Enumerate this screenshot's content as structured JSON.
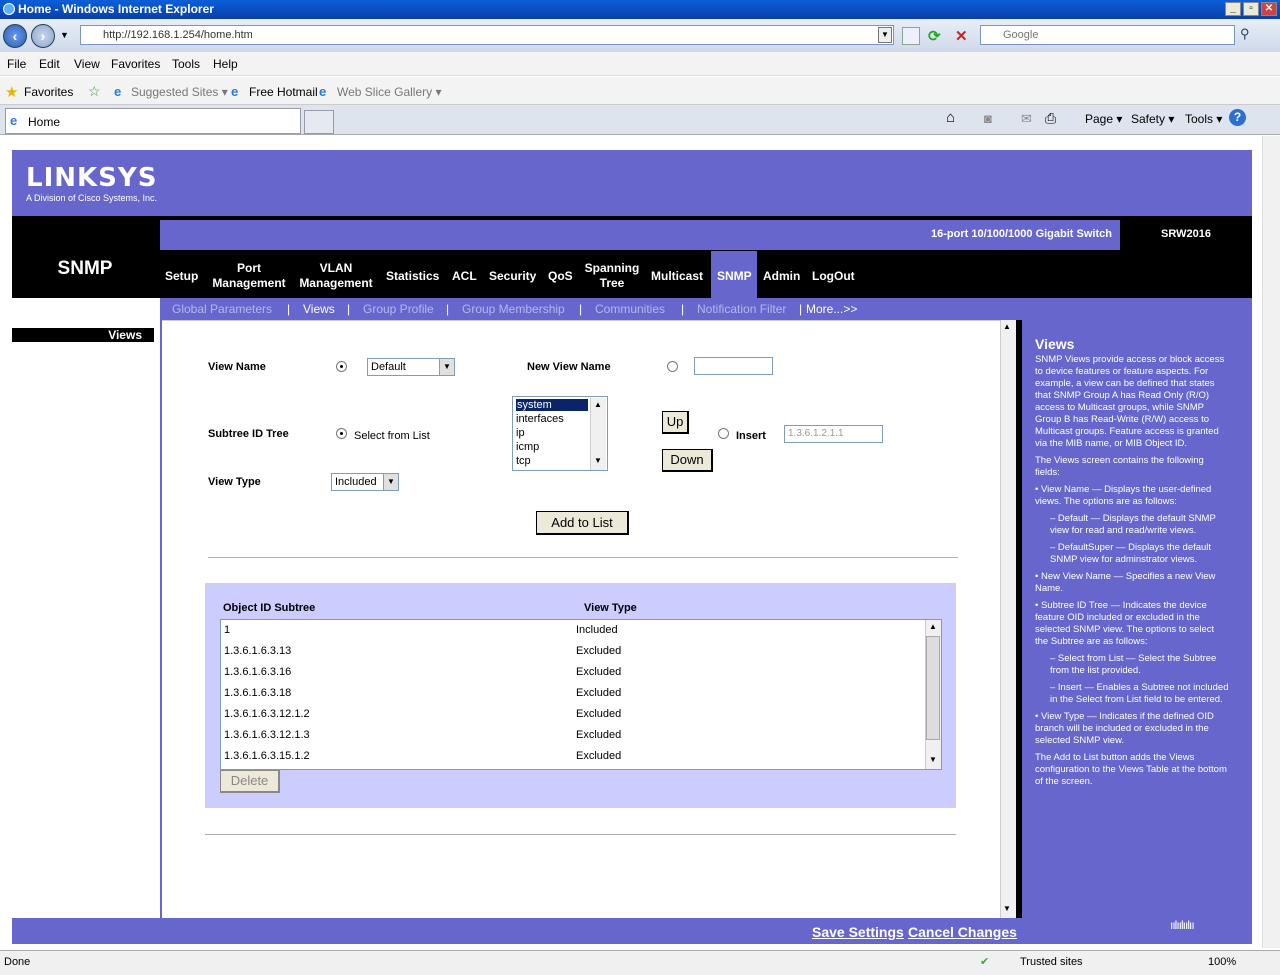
{
  "window": {
    "title": "Home - Windows Internet Explorer",
    "minimize": "_",
    "maximize": "▫",
    "close": "✕"
  },
  "browser": {
    "url": "http://192.168.1.254/home.htm",
    "search_placeholder": "Google",
    "menu": [
      "File",
      "Edit",
      "View",
      "Favorites",
      "Tools",
      "Help"
    ],
    "favorites_label": "Favorites",
    "fav_links": [
      "Suggested Sites ▾",
      "Free Hotmail",
      "Web Slice Gallery ▾"
    ],
    "tab_title": "Home",
    "commands": [
      "Page ▾",
      "Safety ▾",
      "Tools ▾"
    ],
    "status": "Done",
    "zone": "Trusted sites",
    "zoom": "100%"
  },
  "brand": {
    "logo": "LINKSYS",
    "tagline": "A Division of Cisco Systems, Inc.",
    "product": "16-port 10/100/1000 Gigabit Switch",
    "model": "SRW2016",
    "footer_logo": "ıılıılıılıı"
  },
  "section_title": "SNMP",
  "nav": [
    {
      "label": "Setup"
    },
    {
      "label": "Port Management"
    },
    {
      "label": "VLAN Management"
    },
    {
      "label": "Statistics"
    },
    {
      "label": "ACL"
    },
    {
      "label": "Security"
    },
    {
      "label": "QoS"
    },
    {
      "label": "Spanning Tree"
    },
    {
      "label": "Multicast"
    },
    {
      "label": "SNMP"
    },
    {
      "label": "Admin"
    },
    {
      "label": "LogOut"
    }
  ],
  "subnav": [
    "Global Parameters",
    "Views",
    "Group Profile",
    "Group Membership",
    "Communities",
    "Notification Filter",
    "More...>>"
  ],
  "left_label": "Views",
  "form": {
    "view_name_label": "View Name",
    "view_name_value": "Default",
    "new_view_label": "New View Name",
    "subtree_label": "Subtree ID Tree",
    "select_from_list": "Select from List",
    "subtree_options": [
      "system",
      "interfaces",
      "ip",
      "icmp",
      "tcp"
    ],
    "up_label": "Up",
    "down_label": "Down",
    "insert_label": "Insert",
    "insert_placeholder": "1.3.6.1.2.1.1",
    "view_type_label": "View Type",
    "view_type_value": "Included",
    "add_button": "Add to List",
    "delete_button": "Delete"
  },
  "table": {
    "headers": [
      "Object ID Subtree",
      "View Type"
    ],
    "rows": [
      [
        "1",
        "Included"
      ],
      [
        "1.3.6.1.6.3.13",
        "Excluded"
      ],
      [
        "1.3.6.1.6.3.16",
        "Excluded"
      ],
      [
        "1.3.6.1.6.3.18",
        "Excluded"
      ],
      [
        "1.3.6.1.6.3.12.1.2",
        "Excluded"
      ],
      [
        "1.3.6.1.6.3.12.1.3",
        "Excluded"
      ],
      [
        "1.3.6.1.6.3.15.1.2",
        "Excluded"
      ]
    ]
  },
  "help": {
    "title": "Views",
    "intro": "SNMP Views provide access or block access to device features or feature aspects. For example, a view can be defined that states that SNMP Group A has Read Only (R/O) access to Multicast groups, while SNMP Group B has Read-Write (R/W) access to Multicast groups. Feature access is granted via the MIB name, or MIB Object ID.",
    "fields_intro": "The Views screen contains the following fields:",
    "vn": "• View Name — Displays the user-defined views. The options are as follows:",
    "vn1": "– Default — Displays the default SNMP view for read and read/write views.",
    "vn2": "– DefaultSuper — Displays the default SNMP view for adminstrator views.",
    "nvn": "• New View Name — Specifies a new View Name.",
    "st": "• Subtree ID Tree — Indicates the device feature OID included or excluded in the selected SNMP view. The options to select the Subtree are as follows:",
    "st1": "– Select from List — Select the Subtree from the list provided.",
    "st2": "– Insert — Enables a Subtree not included in the Select from List field to be entered.",
    "vt": "• View Type — Indicates if the defined OID branch will be included or excluded in the selected SNMP view.",
    "add": "The Add to List button adds the Views configuration to the Views Table at the bottom of the screen."
  },
  "footer": {
    "save": "Save Settings",
    "cancel": "Cancel Changes"
  },
  "colors": {
    "brand_blue": "#6666cc",
    "black": "#000000",
    "table_bg": "#ccccff"
  }
}
